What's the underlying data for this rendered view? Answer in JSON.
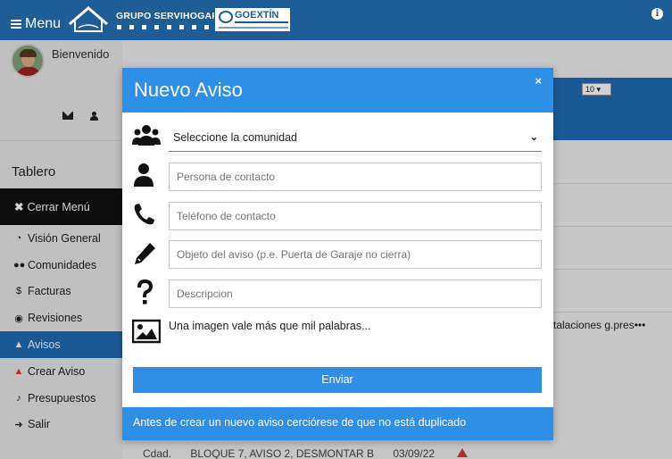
{
  "header": {
    "menu_label": "Menu",
    "brand_name": "GRUPO SERVIHOGAR",
    "partner_logo_text": "GOEXTÍN",
    "info_icon": "info-icon"
  },
  "sidebar": {
    "welcome": "Bienvenido",
    "section_title": "Tablero",
    "close_menu": "Cerrar Menú",
    "items": [
      {
        "label": "Visión General",
        "icon": "tachometer-icon"
      },
      {
        "label": "Comunidades",
        "icon": "users-icon"
      },
      {
        "label": "Facturas",
        "icon": "dollar-icon"
      },
      {
        "label": "Revisiones",
        "icon": "eye-icon"
      },
      {
        "label": "Avisos",
        "icon": "warning-icon",
        "active": true
      },
      {
        "label": "Crear Aviso",
        "icon": "warning-red-icon"
      },
      {
        "label": "Presupuestos",
        "icon": "bell-icon"
      },
      {
        "label": "Salir",
        "icon": "sign-out-icon"
      }
    ]
  },
  "background": {
    "page_size_value": "10",
    "row_text": "talaciones g.pres•••",
    "bottom_row": [
      "Cdad.",
      "BLOQUE 7, AVISO 2, DESMONTAR B",
      "03/09/22"
    ]
  },
  "modal": {
    "title": "Nuevo Aviso",
    "close_symbol": "×",
    "community_select": "Seleccione la comunidad",
    "contact_placeholder": "Persona de contacto",
    "phone_placeholder": "Teléfono de contacto",
    "subject_placeholder": "Objeto del aviso (p.e. Puerta de Garaje no cierra)",
    "description_placeholder": "Descripcion",
    "image_label": "Una imagen vale más que mil palabras...",
    "submit_label": "Enviar",
    "footer_note": "Antes de crear un nuevo aviso cerciórese de que no está duplicado"
  },
  "colors": {
    "header_bg": "#1f5d98",
    "modal_accent": "#2d8fe6",
    "active_nav": "#1f6db8",
    "warning_red": "#d93a3a"
  }
}
